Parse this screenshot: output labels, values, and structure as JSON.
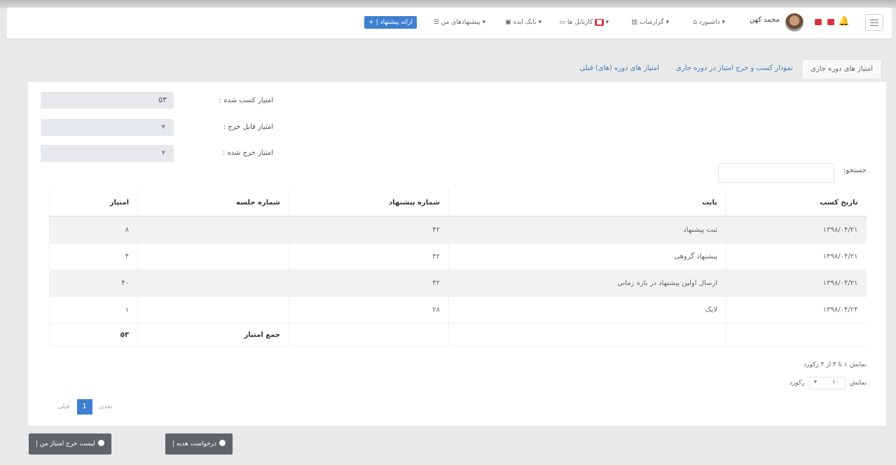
{
  "navbar": {
    "user_name": "محمد کهن",
    "user_sub": "",
    "menus": [
      "داشبورد",
      "گزارشات",
      "کارتابل ها",
      "بانک ایده",
      "پیشنهادهای من"
    ],
    "cta": "ارائه پیشنهاد | +"
  },
  "tabs": [
    "امتیاز های دوره جاری",
    "نمودار کسب و خرج امتیاز در دوره جاری",
    "امتیاز های دوره (های) قبلی"
  ],
  "fields": {
    "earned_label": "امتیاز کسب شده :",
    "earned_value": "۵۳",
    "spendable_label": "امتیاز قابل خرج :",
    "spent_label": "امتیاز خرج شده :"
  },
  "search": {
    "label": "جستجو:",
    "placeholder": ""
  },
  "table": {
    "headers": [
      "تاریخ کسب",
      "بابت",
      "شماره پیشنهاد",
      "شماره جلسه",
      "امتیاز"
    ],
    "rows": [
      [
        "۱۳۹۸/۰۴/۲۱",
        "ثبت پیشنهاد",
        "۴۲",
        "",
        "۸"
      ],
      [
        "۱۳۹۸/۰۴/۲۱",
        "پیشنهاد گروهی",
        "۴۲",
        "",
        "۴"
      ],
      [
        "۱۳۹۸/۰۴/۲۱",
        "ارسال اولین پیشنهاد در بازه زمانی",
        "۴۲",
        "",
        "۴۰"
      ],
      [
        "۱۳۹۸/۰۴/۲۴",
        "لایک",
        "۲۸",
        "",
        "۱"
      ]
    ],
    "footer_label": "جمع امتیاز",
    "footer_total": "۵۳"
  },
  "info_text": "نمایش ۱ تا ۴ از ۴ رکورد",
  "length": {
    "prefix": "نمایش",
    "value": "۱۰",
    "suffix": "رکورد"
  },
  "pager": {
    "prev": "قبلی",
    "current": "1",
    "next": "بعدی"
  },
  "buttons": {
    "gift": "درخواست هدیه |",
    "spend_list": "لیست خرج امتیاز من |"
  },
  "colors": {
    "primary": "#3e7fd0",
    "dark_button": "#5e6468",
    "badge": "#d9333f"
  }
}
